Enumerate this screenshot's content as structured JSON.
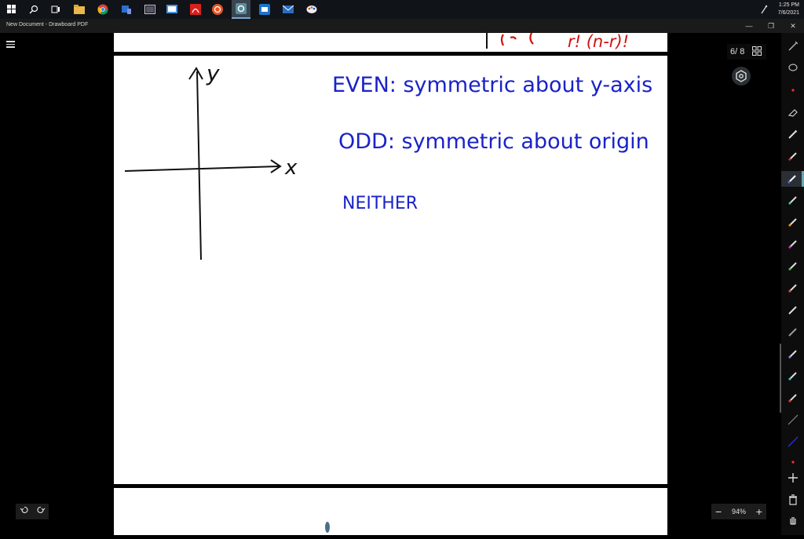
{
  "taskbar": {
    "icons": [
      "windows-start",
      "search",
      "task-view",
      "file-explorer",
      "chrome",
      "teams",
      "tablet",
      "whiteboard",
      "acrobat",
      "ubuntu",
      "drawboard",
      "outlook-like",
      "mail",
      "paint"
    ],
    "clock": {
      "time": "1:25 PM",
      "date": "7/6/2021"
    }
  },
  "titlebar": {
    "title": "New Document - Drawboard PDF",
    "minimize": "—",
    "restore": "❐",
    "close": "✕"
  },
  "viewer": {
    "page_indicator": "6/ 8",
    "zoom": "94%",
    "zoom_out": "−",
    "zoom_in": "+"
  },
  "page_content": {
    "top_fragment_red": "r! (n-r)!",
    "axis_y_label": "y",
    "axis_x_label": "x",
    "even_line": "EVEN: symmetric about y-axis",
    "odd_line": "ODD: symmetric about origin",
    "neither_line": "NEITHER"
  },
  "colors": {
    "ink_blue": "#1a22c8",
    "ink_red": "#d01010",
    "ink_black": "#111111",
    "app_bg": "#000000",
    "taskbar_bg": "#101418"
  }
}
